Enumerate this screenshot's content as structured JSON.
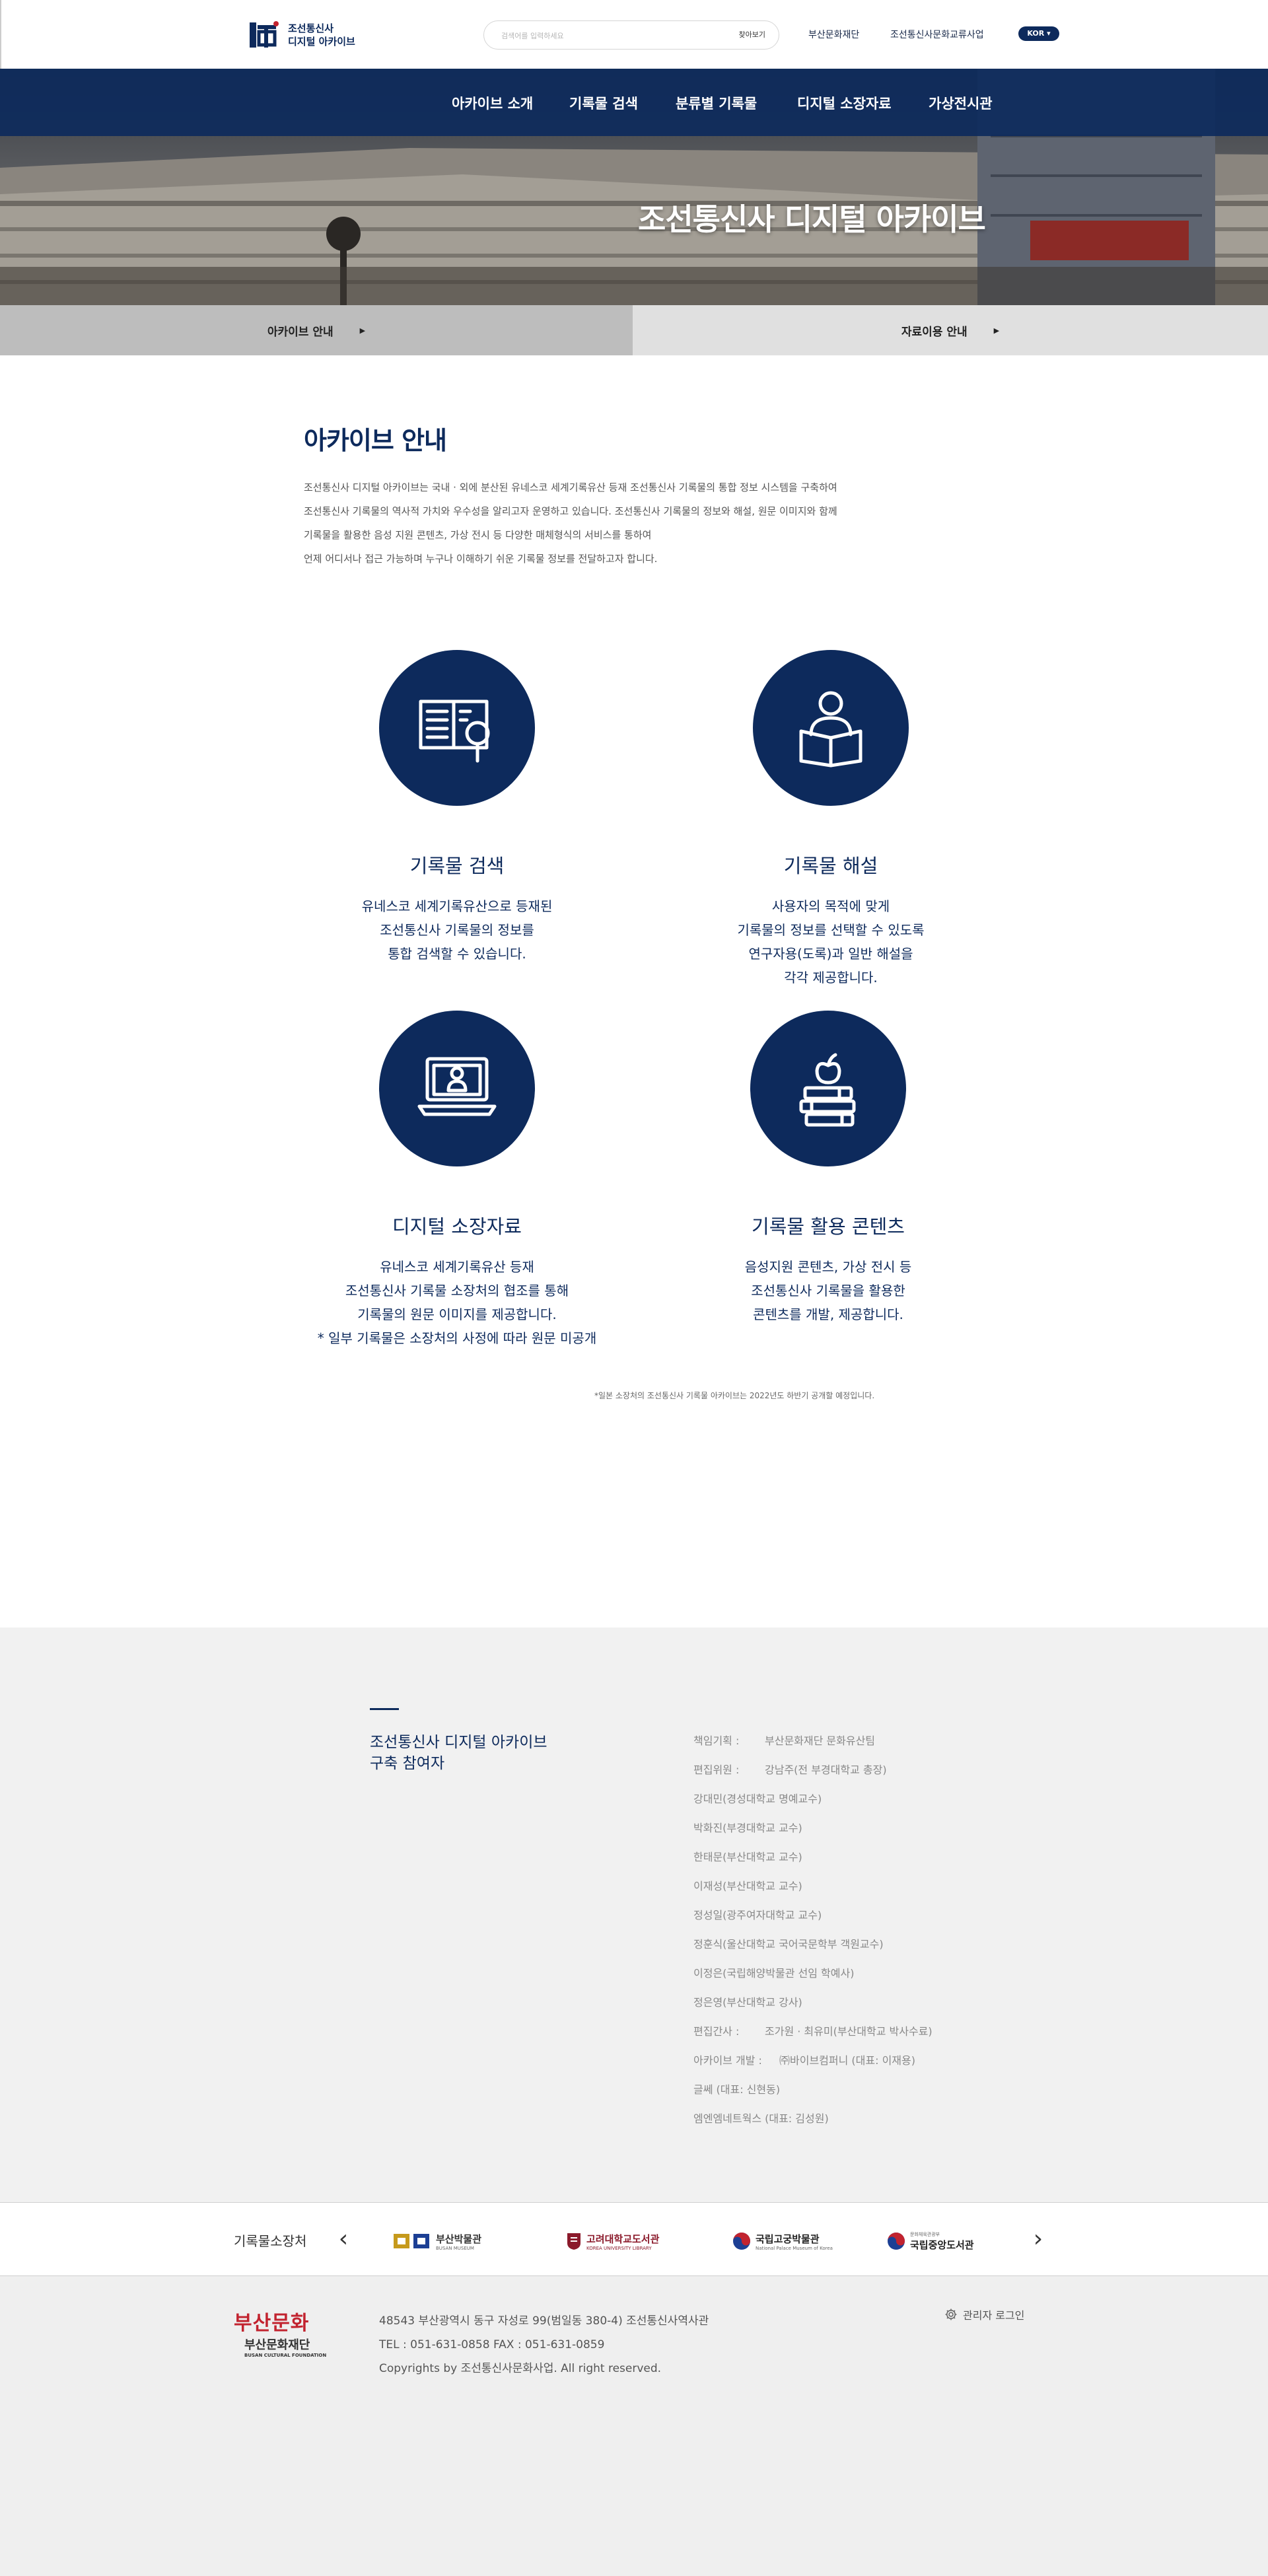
{
  "header": {
    "logo_line1": "조선통신사",
    "logo_line2": "디지털 아카이브",
    "search_placeholder": "검색어를 입력하세요",
    "search_button": "찾아보기",
    "util_links": [
      "부산문화재단",
      "조선통신사문화교류사업"
    ],
    "lang": "KOR ▾"
  },
  "nav": {
    "items": [
      "아카이브 소개",
      "기록물 검색",
      "분류별 기록물",
      "디지털 소장자료",
      "가상전시관"
    ]
  },
  "hero": {
    "title": "조선통신사 디지털 아카이브"
  },
  "tabs": [
    {
      "label": "아카이브 안내",
      "arrow": "▶"
    },
    {
      "label": "자료이용 안내",
      "arrow": "▶"
    }
  ],
  "intro": {
    "title": "아카이브 안내",
    "lines": [
      "조선통신사 디지털 아카이브는 국내 · 외에 분산된 유네스코 세계기록유산 등재 조선통신사 기록물의 통합 정보 시스템을 구축하여",
      "조선통신사 기록물의 역사적 가치와 우수성을 알리고자 운영하고 있습니다. 조선통신사 기록물의 정보와 해설, 원문 이미지와 함께",
      "기록물을 활용한 음성 지원 콘텐츠, 가상 전시 등 다양한 매체형식의 서비스를 통하여",
      "언제 어디서나 접근 가능하며 누구나 이해하기 쉬운 기록물 정보를 전달하고자 합니다."
    ]
  },
  "features": [
    {
      "icon": "book-search-icon",
      "title": "기록물 검색",
      "desc": [
        "유네스코 세계기록유산으로 등재된",
        "조선통신사 기록물의 정보를",
        "통합 검색할 수 있습니다."
      ]
    },
    {
      "icon": "reader-icon",
      "title": "기록물 해설",
      "desc": [
        "사용자의 목적에 맞게",
        "기록물의 정보를 선택할 수 있도록",
        "연구자용(도록)과 일반 해설을",
        "각각 제공합니다."
      ]
    },
    {
      "icon": "laptop-user-icon",
      "title": "디지털 소장자료",
      "desc": [
        "유네스코 세계기록유산 등재",
        "조선통신사 기록물 소장처의 협조를 통해",
        "기록물의 원문 이미지를 제공합니다.",
        "* 일부 기록물은 소장처의 사정에 따라 원문 미공개"
      ]
    },
    {
      "icon": "books-apple-icon",
      "title": "기록물 활용 콘텐츠",
      "desc": [
        "음성지원 콘텐츠, 가상 전시 등",
        "조선통신사 기록물을 활용한",
        "콘텐츠를 개발, 제공합니다."
      ]
    }
  ],
  "note": "*일본 소장처의 조선통신사 기록물 아카이브는 2022년도 하반기 공개할 예정입니다.",
  "contributors": {
    "title_line1": "조선통신사 디지털 아카이브",
    "title_line2": "구축 참여자",
    "rows": [
      {
        "label": "책임기획 :",
        "value": "부산문화재단 문화유산팀"
      },
      {
        "label": "편집위원 :",
        "value": "강남주(전 부경대학교 총장)"
      },
      {
        "label": "",
        "value": "강대민(경성대학교 명예교수)"
      },
      {
        "label": "",
        "value": "박화진(부경대학교 교수)"
      },
      {
        "label": "",
        "value": "한태문(부산대학교 교수)"
      },
      {
        "label": "",
        "value": "이재성(부산대학교 교수)"
      },
      {
        "label": "",
        "value": "정성일(광주여자대학교 교수)"
      },
      {
        "label": "",
        "value": "정훈식(울산대학교 국어국문학부 객원교수)"
      },
      {
        "label": "",
        "value": "이정은(국립해양박물관 선임 학예사)"
      },
      {
        "label": "",
        "value": "정은영(부산대학교 강사)"
      },
      {
        "label": "편집간사 :",
        "value": "조가원 · 최유미(부산대학교 박사수료)"
      },
      {
        "label": "아카이브 개발 :",
        "value": "㈜바이브컴퍼니 (대표: 이재용)"
      },
      {
        "label": "",
        "value": "글쎄 (대표: 신현동)"
      },
      {
        "label": "",
        "value": "엠엔엠네트웍스 (대표: 김성원)"
      }
    ]
  },
  "holders": {
    "label": "기록물소장처",
    "prev": "‹",
    "next": "›",
    "logos": [
      {
        "name": "부산박물관",
        "sub": "BUSAN MUSEUM"
      },
      {
        "name": "고려대학교도서관",
        "sub": "KOREA UNIVERSITY LIBRARY"
      },
      {
        "name": "국립고궁박물관",
        "sub": "National Palace Museum of Korea"
      },
      {
        "name": "국립중앙도서관",
        "sub": "문화체육관광부"
      }
    ]
  },
  "footer": {
    "logo_mark": "부산문화",
    "logo_name": "부산문화재단",
    "logo_en": "BUSAN CULTURAL FOUNDATION",
    "address": "48543 부산광역시 동구 자성로 99(범일동 380-4) 조선통신사역사관",
    "tel": "TEL : 051-631-0858  FAX : 051-631-0859",
    "copyright": "Copyrights by 조선통신사문화사업. All right reserved.",
    "admin_login": "관리자 로그인"
  },
  "colors": {
    "primary": "#0d2a5c",
    "accent_red": "#c2232f",
    "footer_bg": "#efefef"
  }
}
